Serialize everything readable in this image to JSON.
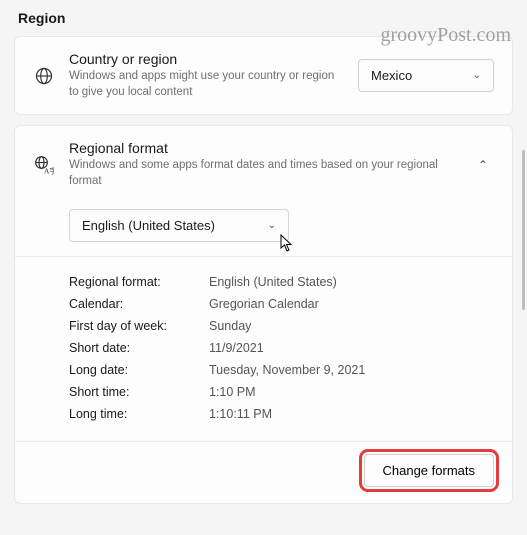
{
  "watermark": "groovyPost.com",
  "page_title": "Region",
  "country": {
    "heading": "Country or region",
    "sub": "Windows and apps might use your country or region to give you local content",
    "selected": "Mexico"
  },
  "regional": {
    "heading": "Regional format",
    "sub": "Windows and some apps format dates and times based on your regional format",
    "selected": "English (United States)"
  },
  "details": {
    "labels": {
      "regional_format": "Regional format:",
      "calendar": "Calendar:",
      "first_day": "First day of week:",
      "short_date": "Short date:",
      "long_date": "Long date:",
      "short_time": "Short time:",
      "long_time": "Long time:"
    },
    "values": {
      "regional_format": "English (United States)",
      "calendar": "Gregorian Calendar",
      "first_day": "Sunday",
      "short_date": "11/9/2021",
      "long_date": "Tuesday, November 9, 2021",
      "short_time": "1:10 PM",
      "long_time": "1:10:11 PM"
    }
  },
  "change_formats": "Change formats"
}
